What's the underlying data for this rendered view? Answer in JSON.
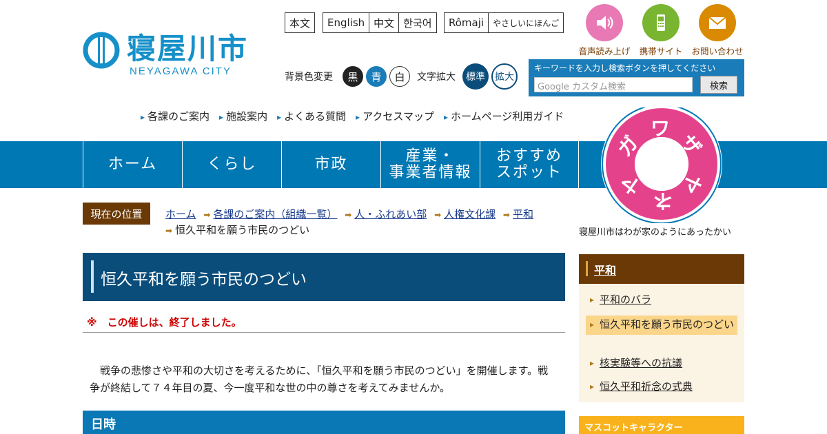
{
  "logo": {
    "name_jp": "寝屋川市",
    "name_en": "NEYAGAWA CITY"
  },
  "lang_links": {
    "body": "本文",
    "english": "English",
    "chinese": "中文",
    "korean": "한국어",
    "romaji": "Rômaji",
    "easy_japanese": "やさしいにほんご"
  },
  "top_icons": [
    {
      "label": "音声読み上げ",
      "icon": "speaker-icon",
      "color": "#e879b4"
    },
    {
      "label": "携帯サイト",
      "icon": "mobile-phone-icon",
      "color": "#79b530"
    },
    {
      "label": "お問い合わせ",
      "icon": "envelope-icon",
      "color": "#d98a00"
    }
  ],
  "settings": {
    "bg_label": "背景色変更",
    "bg_black": "黒",
    "bg_blue": "青",
    "bg_white": "白",
    "text_label": "文字拡大",
    "text_standard": "標準",
    "text_large": "拡大"
  },
  "search": {
    "hint": "キーワードを入力し検索ボタンを押してください",
    "placeholder": "Google カスタム検索",
    "button": "検索"
  },
  "util_nav": [
    "各課のご案内",
    "施設案内",
    "よくある質問",
    "アクセスマップ",
    "ホームページ利用ガイド"
  ],
  "main_nav": {
    "home": "ホーム",
    "life": "くらし",
    "gov": "市政",
    "biz1": "産業・",
    "biz2": "事業者情報",
    "spot1": "おすすめ",
    "spot2": "スポット"
  },
  "badge": {
    "chars": [
      "ガ",
      "ワ",
      "ザ",
      "ヤ",
      "ネ",
      "ヤ"
    ],
    "ring_color": "#e4438c"
  },
  "slogan": "寝屋川市はわが家のようにあったかい",
  "breadcrumb": {
    "here_label": "現在の位置",
    "items": [
      "ホーム",
      "各課のご案内（組織一覧）",
      "人・ふれあい部",
      "人権文化課",
      "平和",
      "恒久平和を願う市民のつどい"
    ]
  },
  "page": {
    "title": "恒久平和を願う市民のつどい",
    "notice": "※　この催しは、終了しました。",
    "body": "戦争の悲惨さや平和の大切さを考えるために、「恒久平和を願う市民のつどい」を開催します。戦争が終結して７４年目の夏、今一度平和な世の中の尊さを考えてみませんか。",
    "section_date": "日時"
  },
  "sidebar": {
    "heading": "平和",
    "items": [
      "平和のバラ",
      "恒久平和を願う市民のつどい",
      "核実験等への抗議",
      "恒久平和祈念の式典"
    ],
    "mascot_banner": "マスコットキャラクター"
  }
}
